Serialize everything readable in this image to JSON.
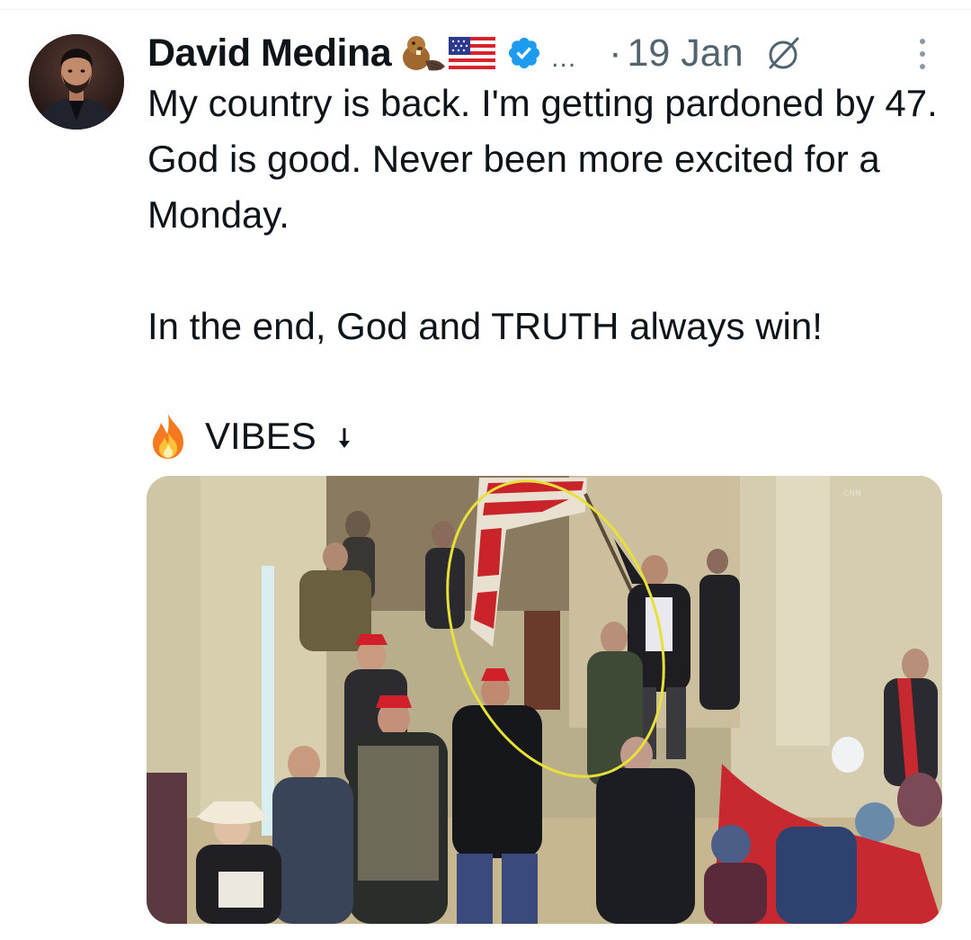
{
  "tweet": {
    "author": {
      "display_name": "David Medina",
      "name_emoji": [
        "beaver-icon",
        "us-flag-icon"
      ],
      "verified": true
    },
    "header_ellipsis": "...",
    "date_separator": "·",
    "date": "19 Jan",
    "text_paragraphs": [
      "My country is back. I'm getting pardoned by 47. God is good. Never been more excited for a Monday.",
      "In the end, God and TRUTH always win!"
    ],
    "vibes_line": {
      "icon": "fire-icon",
      "text": "VIBES",
      "arrow": "down-arrow-icon"
    },
    "media": {
      "type": "photo",
      "highlight": "yellow-ellipse"
    }
  },
  "colors": {
    "text": "#0f1419",
    "secondary": "#536471",
    "verified": "#1d9bf0",
    "highlight": "#e8e03a"
  }
}
